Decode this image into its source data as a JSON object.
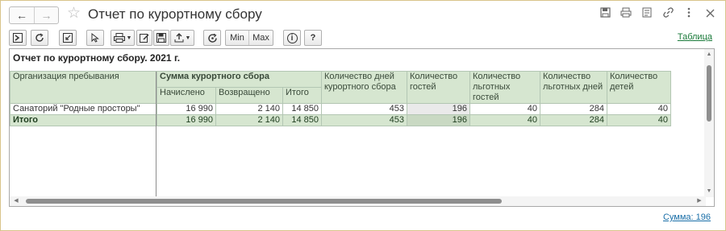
{
  "window": {
    "title": "Отчет по курортному сбору",
    "back_icon": "←",
    "forward_icon": "→",
    "star_icon": "☆"
  },
  "toolbar": {
    "min_label": "Min",
    "max_label": "Max",
    "info_label": "i",
    "help_label": "?",
    "table_link": "Таблица"
  },
  "report": {
    "title": "Отчет по курортному сбору. 2021 г.",
    "headers": {
      "org": "Организация пребывания",
      "fee_group": "Сумма курортного сбора",
      "accrued": "Начислено",
      "returned": "Возвращено",
      "total": "Итого",
      "days": "Количество дней курортного сбора",
      "guests": "Количество гостей",
      "pref_guests": "Количество льготных гостей",
      "pref_days": "Количество льготных дней",
      "children": "Количество детей"
    },
    "rows": [
      {
        "org": "Санаторий \"Родные просторы\"",
        "accrued": "16 990",
        "returned": "2 140",
        "total": "14 850",
        "days": "453",
        "guests": "196",
        "pref_guests": "40",
        "pref_days": "284",
        "children": "40"
      }
    ],
    "totals": {
      "org": "Итого",
      "accrued": "16 990",
      "returned": "2 140",
      "total": "14 850",
      "days": "453",
      "guests": "196",
      "pref_guests": "40",
      "pref_days": "284",
      "children": "40"
    }
  },
  "status": {
    "sum_label": "Сумма: 196"
  },
  "colors": {
    "header_bg": "#d6e6d0",
    "link_green": "#1a7a3a",
    "link_blue": "#1a6fa8"
  }
}
